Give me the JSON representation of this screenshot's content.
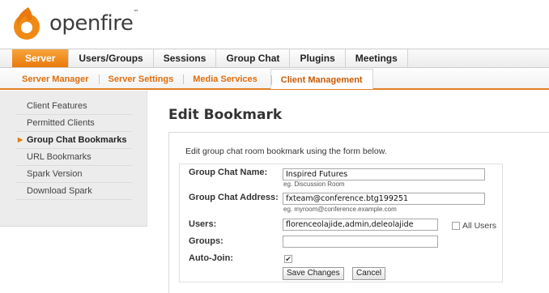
{
  "brand": {
    "name": "openfire",
    "trademark": "™",
    "accent": "#e9790c"
  },
  "topnav": {
    "tabs": [
      {
        "label": "Server",
        "active": true
      },
      {
        "label": "Users/Groups"
      },
      {
        "label": "Sessions"
      },
      {
        "label": "Group Chat"
      },
      {
        "label": "Plugins"
      },
      {
        "label": "Meetings"
      }
    ]
  },
  "subnav": {
    "tabs": [
      {
        "label": "Server Manager"
      },
      {
        "label": "Server Settings"
      },
      {
        "label": "Media Services"
      },
      {
        "label": "Client Management",
        "active": true
      }
    ]
  },
  "sidebar": {
    "items": [
      {
        "label": "Client Features"
      },
      {
        "label": "Permitted Clients"
      },
      {
        "label": "Group Chat Bookmarks",
        "active": true
      },
      {
        "label": "URL Bookmarks"
      },
      {
        "label": "Spark Version"
      },
      {
        "label": "Download Spark"
      }
    ]
  },
  "main": {
    "title": "Edit Bookmark",
    "intro": "Edit group chat room bookmark using the form below.",
    "form": {
      "name_label": "Group Chat Name:",
      "name_value": "Inspired Futures",
      "name_hint": "eg. Discussion Room",
      "address_label": "Group Chat Address:",
      "address_value": "fxteam@conference.btg199251",
      "address_hint": "eg. myroom@conference.example.com",
      "users_label": "Users:",
      "users_value": "florenceolajide,admin,deleolajide",
      "all_users_label": "All Users",
      "all_users_checked": false,
      "groups_label": "Groups:",
      "groups_value": "",
      "autojoin_label": "Auto-Join:",
      "autojoin_checked": true,
      "autojoin_mark": "✔",
      "save_label": "Save Changes",
      "cancel_label": "Cancel"
    }
  }
}
